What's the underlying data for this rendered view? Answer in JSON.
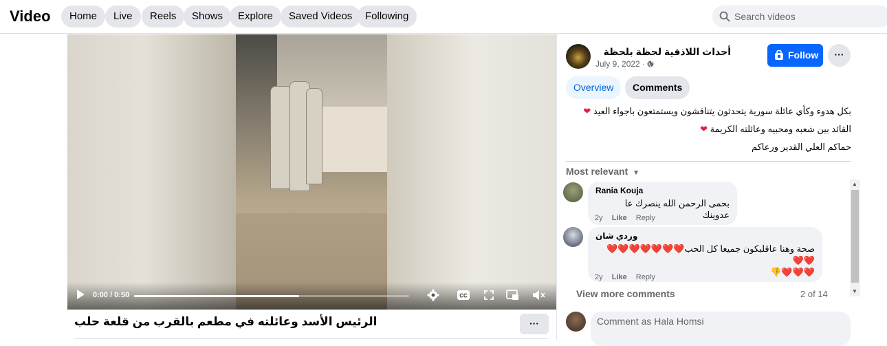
{
  "header": {
    "title": "Video",
    "nav": [
      "Home",
      "Live",
      "Reels",
      "Shows",
      "Explore",
      "Saved Videos",
      "Following"
    ],
    "search_placeholder": "Search videos"
  },
  "player": {
    "time": "0:00 / 0:50",
    "progress_fraction": 0.6
  },
  "video": {
    "title": "الرئيس الأسد وعائلته في مطعم بالقرب من قلعة حلب",
    "more": "···"
  },
  "post": {
    "page_name": "أحداث اللاذقية لحظة بلحظة",
    "date": "July 9, 2022 ·",
    "follow": "Follow",
    "more": "···",
    "tabs": [
      "Overview",
      "Comments"
    ],
    "description": [
      "بكل هدوء وكأي عائلة سورية يتحدثون يتناقشون ويستمتعون باجواء العيد",
      "القائد بين شعبه ومحبيه وعائلته الكريمة",
      "حماكم العلي القدير ورعاكم"
    ],
    "heart": "❤"
  },
  "comments_header": {
    "sort": "Most relevant"
  },
  "comments": [
    {
      "author": "Rania Kouja",
      "text": "بحمى الرحمن الله ينصرك عا عدوينك",
      "age": "2y",
      "like": "Like",
      "reply": "Reply"
    },
    {
      "author": "وردي شان",
      "text_1": "صحة وهنا عاقلبكون جميعا كل الحب❤️❤️❤️❤️❤️❤️❤️❤️❤️",
      "text_2": "❤️❤️❤️👎",
      "age": "2y",
      "like": "Like",
      "reply": "Reply"
    }
  ],
  "comments_footer": {
    "view_more": "View more comments",
    "count": "2 of 14"
  },
  "composer": {
    "placeholder": "Comment as Hala Homsi"
  }
}
